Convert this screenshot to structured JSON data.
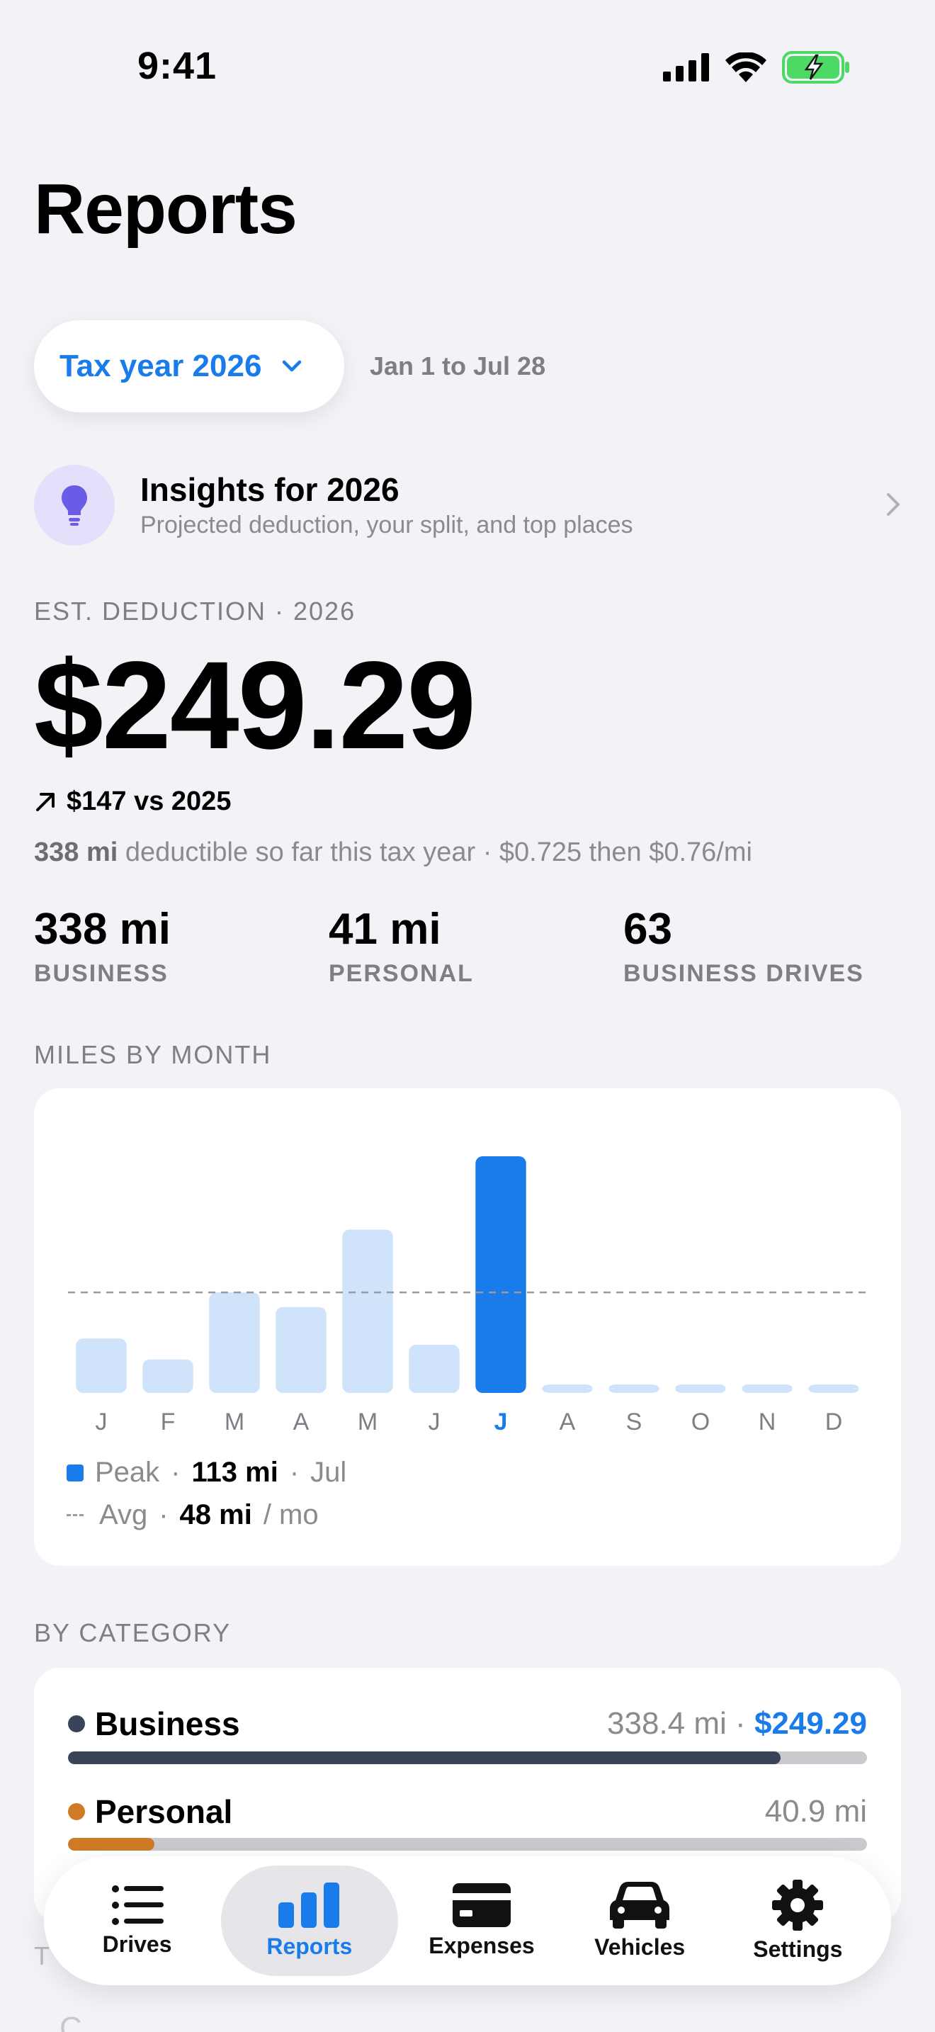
{
  "status_bar": {
    "time": "9:41"
  },
  "header": {
    "title": "Reports"
  },
  "period": {
    "selector_label": "Tax year 2026",
    "range": "Jan 1 to Jul 28"
  },
  "insights": {
    "title": "Insights for 2026",
    "subtitle": "Projected deduction, your split, and top places"
  },
  "deduction": {
    "section_label": "EST. DEDUCTION · 2026",
    "amount": "$249.29",
    "delta": "$147 vs 2025",
    "summary_miles": "338 mi",
    "summary_rest": " deductible so far this tax year · $0.725 then $0.76/mi"
  },
  "stats": [
    {
      "value": "338 mi",
      "label": "BUSINESS"
    },
    {
      "value": "41 mi",
      "label": "PERSONAL"
    },
    {
      "value": "63",
      "label": "BUSINESS DRIVES"
    }
  ],
  "miles_section_label": "MILES BY MONTH",
  "chart_data": {
    "type": "bar",
    "categories": [
      "J",
      "F",
      "M",
      "A",
      "M",
      "J",
      "J",
      "A",
      "S",
      "O",
      "N",
      "D"
    ],
    "values": [
      26,
      16,
      48,
      41,
      78,
      23,
      113,
      0,
      0,
      0,
      0,
      0
    ],
    "highlight_index": 6,
    "average": 48,
    "colors": {
      "bar": "#cfe3fb",
      "highlight": "#1a7bea",
      "avg_line": "#9a9a9f"
    },
    "legend": {
      "peak_label": "Peak",
      "peak_value": "113 mi",
      "peak_month": "Jul",
      "avg_label": "Avg",
      "avg_value": "48 mi",
      "avg_unit": "/ mo"
    }
  },
  "category_section_label": "BY CATEGORY",
  "categories": [
    {
      "name": "Business",
      "miles": "338.4 mi",
      "amount": "$249.29",
      "fraction": 0.892,
      "color": "#3a4459"
    },
    {
      "name": "Personal",
      "miles": "40.9 mi",
      "fraction": 0.108,
      "color": "#cf7b26"
    }
  ],
  "tabs": [
    {
      "label": "Drives",
      "icon": "list-icon"
    },
    {
      "label": "Reports",
      "icon": "bar-chart-icon",
      "active": true
    },
    {
      "label": "Expenses",
      "icon": "card-icon"
    },
    {
      "label": "Vehicles",
      "icon": "car-icon"
    },
    {
      "label": "Settings",
      "icon": "gear-icon"
    }
  ],
  "below_fold": {
    "section_label": "T",
    "text": "C"
  }
}
